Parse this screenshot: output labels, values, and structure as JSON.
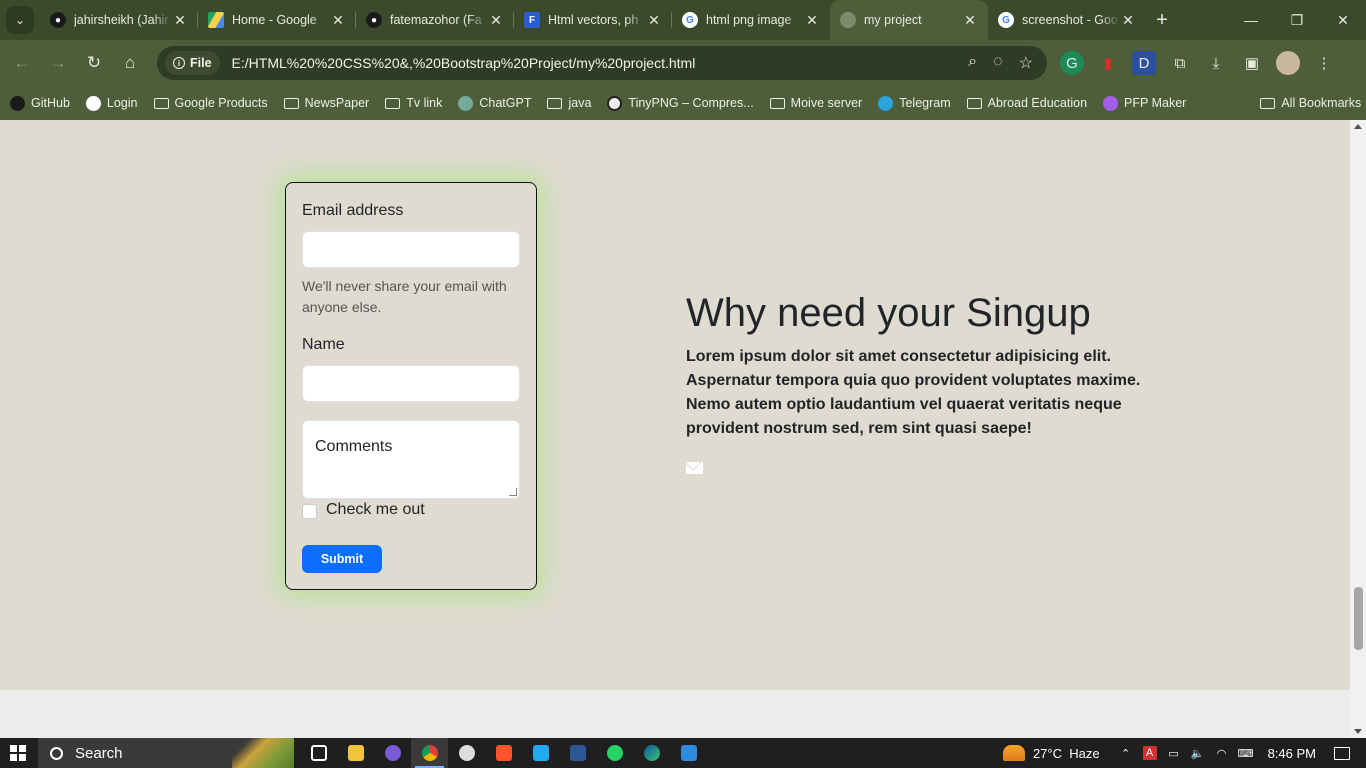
{
  "browser": {
    "tabs": [
      {
        "title": "jahirsheikh (Jahir",
        "favicon": "github-icon",
        "active": false
      },
      {
        "title": "Home - Google",
        "favicon": "google-drive-icon",
        "active": false
      },
      {
        "title": "fatemazohor (Fa",
        "favicon": "github-icon",
        "active": false
      },
      {
        "title": "Html vectors, ph",
        "favicon": "freepik-icon",
        "active": false
      },
      {
        "title": "html png image",
        "favicon": "google-icon",
        "active": false
      },
      {
        "title": "my project",
        "favicon": "globe-icon",
        "active": true
      },
      {
        "title": "screenshot - Goo",
        "favicon": "google-icon",
        "active": false
      }
    ],
    "address": {
      "scheme_label": "File",
      "url": "E:/HTML%20%20CSS%20&,%20Bootstrap%20Project/my%20project.html"
    },
    "bookmarks": [
      {
        "label": "GitHub",
        "icon": "github-icon"
      },
      {
        "label": "Login",
        "icon": "globe-icon"
      },
      {
        "label": "Google Products",
        "icon": "folder-icon"
      },
      {
        "label": "NewsPaper",
        "icon": "folder-icon"
      },
      {
        "label": "Tv link",
        "icon": "folder-icon"
      },
      {
        "label": "ChatGPT",
        "icon": "chatgpt-icon"
      },
      {
        "label": "java",
        "icon": "folder-icon"
      },
      {
        "label": "TinyPNG – Compres...",
        "icon": "panda-icon"
      },
      {
        "label": "Moive server",
        "icon": "folder-icon"
      },
      {
        "label": "Telegram",
        "icon": "telegram-icon"
      },
      {
        "label": "Abroad Education",
        "icon": "folder-icon"
      },
      {
        "label": "PFP Maker",
        "icon": "pfp-icon"
      }
    ],
    "all_bookmarks": "All Bookmarks"
  },
  "page": {
    "form": {
      "email_label": "Email address",
      "email_value": "",
      "email_help": "We'll never share your email with anyone else.",
      "name_label": "Name",
      "name_value": "",
      "comments_placeholder": "Comments",
      "check_label": "Check me out",
      "submit_label": "Submit"
    },
    "info": {
      "title": "Why need your Singup",
      "text": "Lorem ipsum dolor sit amet consectetur adipisicing elit. Aspernatur tempora quia quo provident voluptates maxime. Nemo autem optio laudantium vel quaerat veritatis neque provident nostrum sed, rem sint quasi saepe!"
    },
    "colors": {
      "background": "#dfdbd0",
      "submit": "#0d6efd",
      "card_glow": "#a0e678"
    }
  },
  "taskbar": {
    "search_label": "Search",
    "temperature": "27°C",
    "weather": "Haze",
    "time": "8:46 PM"
  }
}
